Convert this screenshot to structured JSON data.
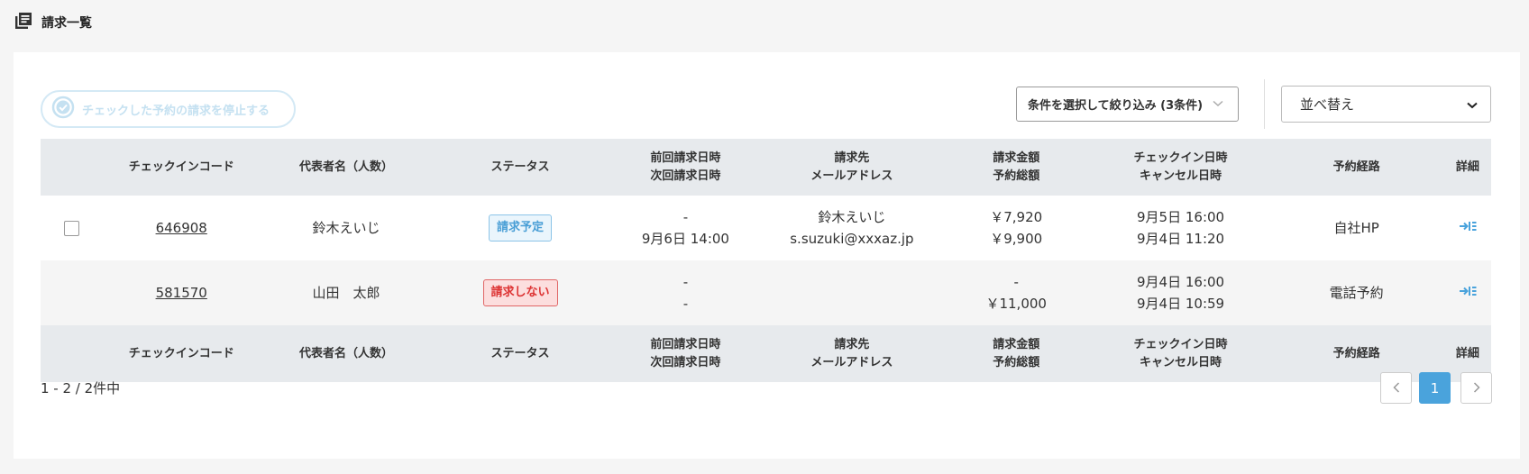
{
  "page": {
    "title": "請求一覧"
  },
  "toolbar": {
    "stop_label": "チェックした予約の請求を停止する",
    "filter_label": "条件を選択して絞り込み (3条件)",
    "sort_label": "並べ替え"
  },
  "table": {
    "headers": {
      "code": "チェックインコード",
      "rep": "代表者名（人数）",
      "status": "ステータス",
      "prev_date": "前回請求日時",
      "next_date": "次回請求日時",
      "billto": "請求先",
      "email": "メールアドレス",
      "amount": "請求金額",
      "total": "予約総額",
      "checkin": "チェックイン日時",
      "cancel": "キャンセル日時",
      "route": "予約経路",
      "detail": "詳細"
    },
    "rows": [
      {
        "code": "646908",
        "rep": "鈴木えいじ",
        "status": "請求予定",
        "prev": "-",
        "next": "9月6日 14:00",
        "billto_name": "鈴木えいじ",
        "billto_email": "s.suzuki@xxxaz.jp",
        "amount": "￥7,920",
        "total": "￥9,900",
        "checkin": "9月5日 16:00",
        "cancel": "9月4日 11:20",
        "route": "自社HP"
      },
      {
        "code": "581570",
        "rep": "山田　太郎",
        "status": "請求しない",
        "prev": "-",
        "next": "-",
        "billto_name": "",
        "billto_email": "",
        "amount": "-",
        "total": "￥11,000",
        "checkin": "9月4日 16:00",
        "cancel": "9月4日 10:59",
        "route": "電話予約"
      }
    ]
  },
  "pagination": {
    "info": "1 - 2 / 2件中",
    "current": "1"
  },
  "colors": {
    "accent": "#4aa3dc",
    "header_bg": "#e7eaed",
    "status_scheduled": "#4a9fd6",
    "status_no_charge": "#dd3333"
  }
}
